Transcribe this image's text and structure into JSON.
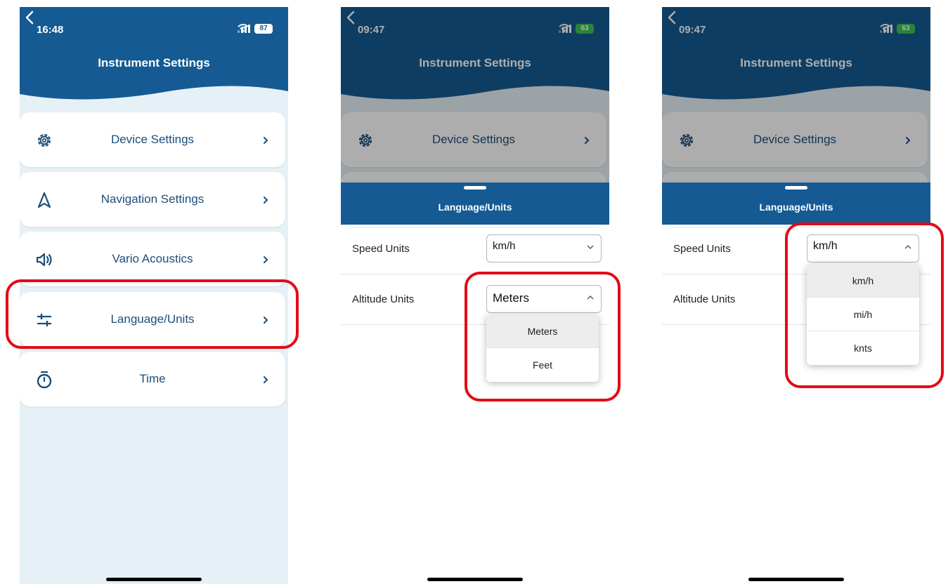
{
  "colors": {
    "header": "#155a93",
    "list_background": "#e6f0f7",
    "highlight": "#e30b17",
    "label": "#1c4d79"
  },
  "phone1": {
    "time": "16:48",
    "battery": "87",
    "title": "Instrument Settings",
    "menu": [
      {
        "label": "Device Settings",
        "icon": "gear-icon"
      },
      {
        "label": "Navigation Settings",
        "icon": "navigation-arrow-icon"
      },
      {
        "label": "Vario Acoustics",
        "icon": "speaker-icon"
      },
      {
        "label": "Language/Units",
        "icon": "sliders-icon"
      },
      {
        "label": "Time",
        "icon": "stopwatch-icon"
      }
    ]
  },
  "phone2": {
    "time": "09:47",
    "battery": "63",
    "title": "Instrument Settings",
    "menu_label": "Device Settings",
    "sheet_title": "Language/Units",
    "speed_label": "Speed Units",
    "speed_value": "km/h",
    "altitude_label": "Altitude Units",
    "altitude_value": "Meters",
    "altitude_options": [
      "Meters",
      "Feet"
    ]
  },
  "phone3": {
    "time": "09:47",
    "battery": "63",
    "title": "Instrument Settings",
    "menu_label": "Device Settings",
    "sheet_title": "Language/Units",
    "speed_label": "Speed Units",
    "speed_value": "km/h",
    "altitude_label": "Altitude Units",
    "speed_options": [
      "km/h",
      "mi/h",
      "knts"
    ]
  }
}
